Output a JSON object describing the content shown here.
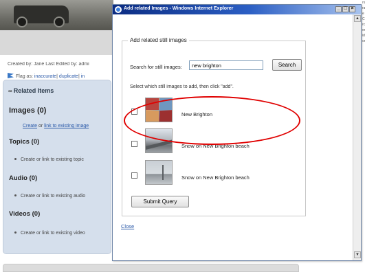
{
  "background_page": {
    "meta_line": "Created by: Jane Last Edited by: admi",
    "flag_label": "Flag as:",
    "flag_options": [
      "inaccurate",
      "duplicate",
      "in"
    ],
    "related_items": {
      "heading": "Related Items",
      "images_title": "Images (0)",
      "images_create": "Create",
      "images_or": "or",
      "images_link": "link to existing image",
      "topics_title": "Topics (0)",
      "topics_item": "Create or link to existing topic",
      "audio_title": "Audio (0)",
      "audio_item": "Create or link to existing audio",
      "videos_title": "Videos (0)",
      "videos_item": "Create or link to existing video"
    }
  },
  "popup": {
    "title": "Add related Images - Windows Internet Explorer",
    "legend": "Add related still images",
    "search_label": "Search for still images:",
    "search_value": "new brighton",
    "search_button": "Search",
    "instructions": "Select which still images to add, then click \"add\".",
    "images": [
      {
        "label": "New Brighton",
        "checked": false
      },
      {
        "label": "Snow on New Brighton beach",
        "checked": false
      },
      {
        "label": "Snow on New Brighton beach",
        "checked": false
      }
    ],
    "submit_button": "Submit Query",
    "close_link": "Close",
    "window_buttons": [
      "_",
      "□",
      "×"
    ]
  },
  "side_text_fragments": [
    "ns",
    "rad",
    "e C",
    "rch",
    "ervi",
    "ide",
    "",
    "org"
  ],
  "colors": {
    "highlight_ellipse": "#e00000",
    "titlebar_start": "#0b2c82",
    "related_panel": "#d5dfec",
    "link": "#2a59a8"
  }
}
